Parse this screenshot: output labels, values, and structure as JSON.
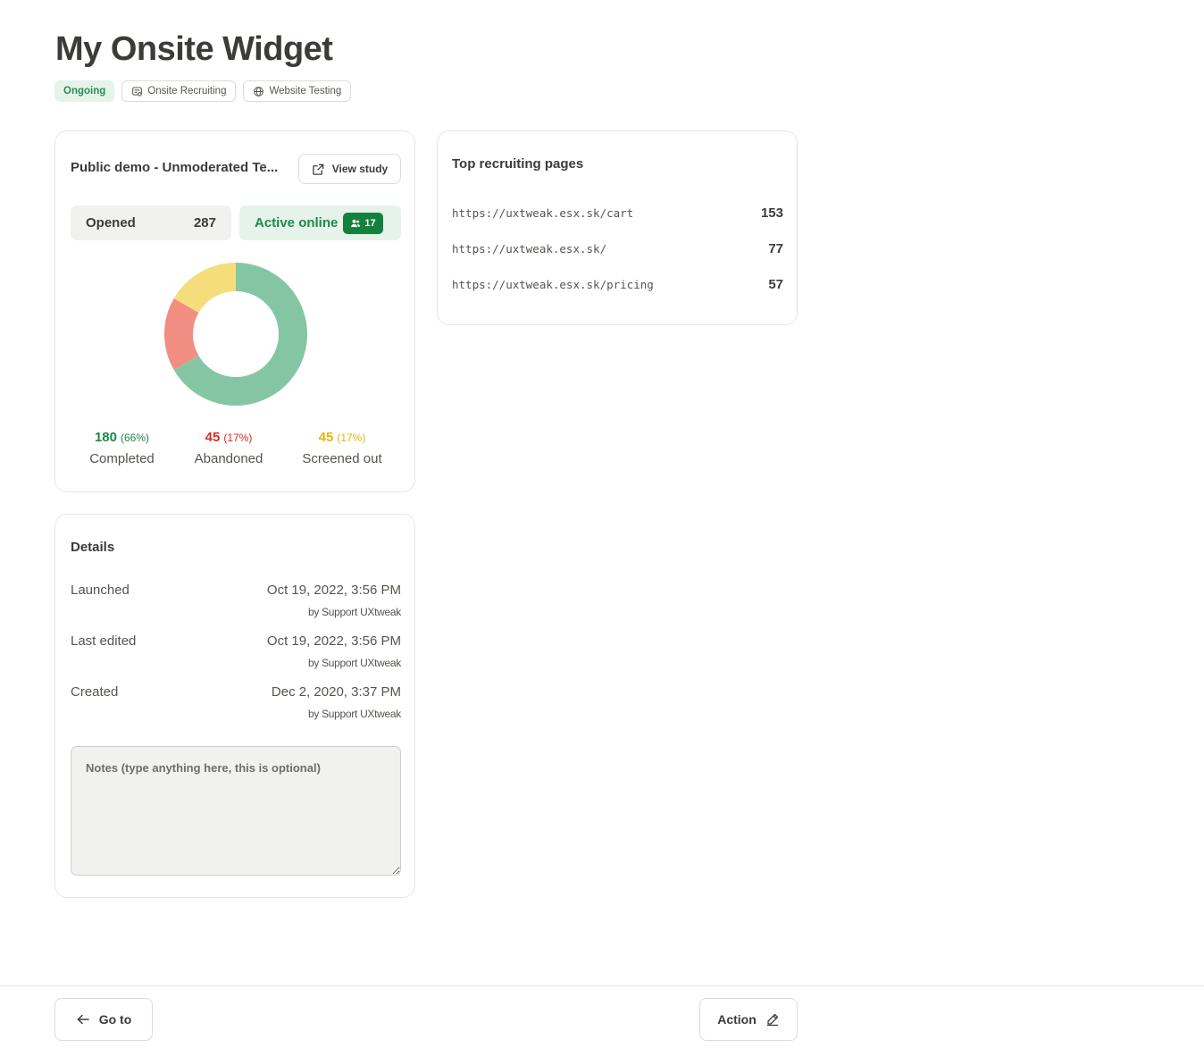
{
  "page": {
    "title": "My Onsite Widget",
    "tags": {
      "status": "Ongoing",
      "recruiting": "Onsite Recruiting",
      "testing": "Website Testing"
    }
  },
  "study": {
    "title": "Public demo - Unmoderated Te...",
    "view_button": "View study",
    "opened_label": "Opened",
    "opened_value": "287",
    "active_label": "Active online",
    "active_value": "17",
    "colors": {
      "completed": "#84c6a4",
      "abandoned": "#f28d82",
      "screened": "#f6dd7b"
    }
  },
  "chart_data": {
    "type": "pie",
    "categories": [
      "Completed",
      "Abandoned",
      "Screened out"
    ],
    "values": [
      180,
      45,
      45
    ],
    "percents": [
      "(66%)",
      "(17%)",
      "(17%)"
    ],
    "donut": true
  },
  "pages": {
    "title": "Top recruiting pages",
    "rows": [
      {
        "url": "https://uxtweak.esx.sk/cart",
        "count": "153"
      },
      {
        "url": "https://uxtweak.esx.sk/",
        "count": "77"
      },
      {
        "url": "https://uxtweak.esx.sk/pricing",
        "count": "57"
      }
    ]
  },
  "details": {
    "title": "Details",
    "rows": [
      {
        "label": "Launched",
        "value": "Oct 19, 2022, 3:56 PM",
        "by": "by Support UXtweak"
      },
      {
        "label": "Last edited",
        "value": "Oct 19, 2022, 3:56 PM",
        "by": "by Support UXtweak"
      },
      {
        "label": "Created",
        "value": "Dec 2, 2020, 3:37 PM",
        "by": "by Support UXtweak"
      }
    ],
    "notes_placeholder": "Notes (type anything here, this is optional)"
  },
  "footer": {
    "goto_label": "Go to",
    "action_label": "Action"
  }
}
